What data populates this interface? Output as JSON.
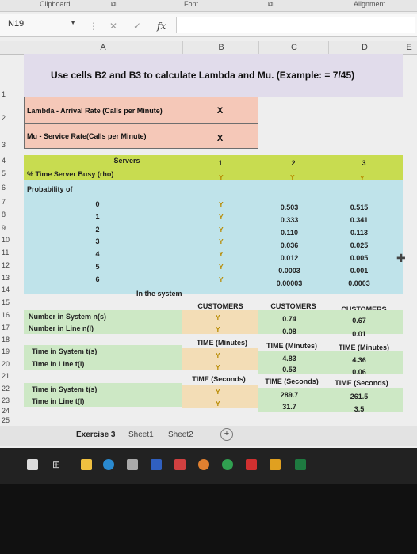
{
  "ribbon": {
    "clipboard": "Clipboard",
    "font": "Font",
    "alignment": "Alignment"
  },
  "formula": {
    "namebox": "N19",
    "fx": "fx",
    "cancel": "✕",
    "enter": "✓",
    "value": ""
  },
  "columns": [
    "A",
    "B",
    "C",
    "D",
    "E"
  ],
  "rows": [
    "1",
    "2",
    "3",
    "4",
    "5",
    "6",
    "7",
    "8",
    "9",
    "10",
    "11",
    "12",
    "13",
    "14",
    "15",
    "16",
    "17",
    "18",
    "19",
    "20",
    "21",
    "22",
    "23",
    "24",
    "25"
  ],
  "title": "Use cells B2 and B3 to calculate Lambda and Mu. (Example: = 7/45)",
  "lambda": {
    "label": "Lambda - Arrival Rate (Calls per Minute)",
    "value": "X"
  },
  "mu": {
    "label": "Mu - Service Rate(Calls per Minute)",
    "value": "X"
  },
  "servers": {
    "label": "Servers",
    "b": "1",
    "c": "2",
    "d": "3"
  },
  "rho": {
    "label": "% Time Server Busy (rho)",
    "b": "Y",
    "c": "Y",
    "d": "Y"
  },
  "prob_label": "Probability of",
  "prob": [
    {
      "n": "0",
      "b": "Y",
      "c": "0.503",
      "d": "0.515"
    },
    {
      "n": "1",
      "b": "Y",
      "c": "0.333",
      "d": "0.341"
    },
    {
      "n": "2",
      "b": "Y",
      "c": "0.110",
      "d": "0.113"
    },
    {
      "n": "3",
      "b": "Y",
      "c": "0.036",
      "d": "0.025"
    },
    {
      "n": "4",
      "b": "Y",
      "c": "0.012",
      "d": "0.005"
    },
    {
      "n": "5",
      "b": "Y",
      "c": "0.0003",
      "d": "0.001"
    },
    {
      "n": "6",
      "b": "Y",
      "c": "0.00003",
      "d": "0.0003"
    }
  ],
  "in_system": "In the system",
  "customers": {
    "b": "CUSTOMERS",
    "c": "CUSTOMERS",
    "d": "CUSTOMERS"
  },
  "ns": {
    "label": "Number in System n(s)",
    "b": "Y",
    "c": "0.74",
    "d": "0.67"
  },
  "nl": {
    "label": "Number in Line n(l)",
    "b": "Y",
    "c": "0.08",
    "d": "0.01"
  },
  "time_min": {
    "b": "TIME (Minutes)",
    "c": "TIME (Minutes)",
    "d": "TIME (Minutes)"
  },
  "ts_min": {
    "label": "Time in System t(s)",
    "b": "Y",
    "c": "4.83",
    "d": "4.36"
  },
  "tl_min": {
    "label": "Time in Line t(l)",
    "b": "Y",
    "c": "0.53",
    "d": "0.06"
  },
  "time_sec": {
    "b": "TIME (Seconds)",
    "c": "TIME (Seconds)",
    "d": "TIME (Seconds)"
  },
  "ts_sec": {
    "label": "Time in System t(s)",
    "b": "Y",
    "c": "289.7",
    "d": "261.5"
  },
  "tl_sec": {
    "label": "Time in Line t(l)",
    "b": "Y",
    "c": "31.7",
    "d": "3.5"
  },
  "sheets": {
    "exercise": "Exercise 3",
    "sheet1": "Sheet1",
    "sheet2": "Sheet2",
    "add": "+"
  },
  "colors": {
    "title_bg": "#e1dceb",
    "pink": "#f5c8b8",
    "lime": "#c8dc50",
    "cyan": "#bfe3ea",
    "green": "#cde8c5",
    "y_text": "#b88a00"
  }
}
